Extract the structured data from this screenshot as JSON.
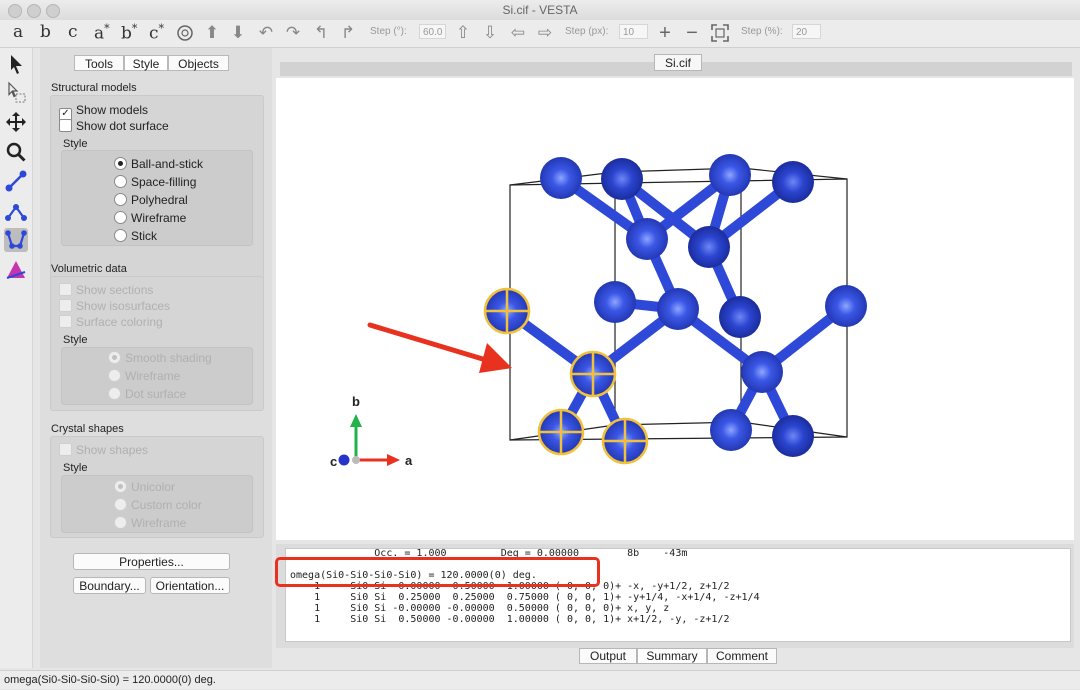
{
  "window": {
    "title": "Si.cif - VESTA"
  },
  "toolbar": {
    "letters": [
      "a",
      "b",
      "c",
      "a",
      "b",
      "c"
    ],
    "stars": [
      "",
      "",
      "",
      "*",
      "*",
      "*"
    ],
    "step_deg_label": "Step (°):",
    "step_deg_value": "60.0",
    "step_px_label": "Step (px):",
    "step_px_value": "10",
    "step_pct_label": "Step (%):",
    "step_pct_value": "20"
  },
  "panel": {
    "tabs": [
      "Tools",
      "Style",
      "Objects"
    ],
    "structural": {
      "title": "Structural models",
      "show_models": "Show models",
      "show_dot": "Show dot surface",
      "style_label": "Style",
      "styles": [
        "Ball-and-stick",
        "Space-filling",
        "Polyhedral",
        "Wireframe",
        "Stick"
      ],
      "check_mark": "✓"
    },
    "volumetric": {
      "title": "Volumetric data",
      "options": [
        "Show sections",
        "Show isosurfaces",
        "Surface coloring"
      ],
      "style_label": "Style",
      "styles": [
        "Smooth shading",
        "Wireframe",
        "Dot surface"
      ]
    },
    "crystal": {
      "title": "Crystal shapes",
      "show_shapes": "Show shapes",
      "style_label": "Style",
      "styles": [
        "Unicolor",
        "Custom color",
        "Wireframe"
      ]
    },
    "buttons": {
      "properties": "Properties...",
      "boundary": "Boundary...",
      "orientation": "Orientation..."
    }
  },
  "viewer": {
    "tab": "Si.cif",
    "axis_a": "a",
    "axis_b": "b",
    "axis_c": "c"
  },
  "output": {
    "lines": [
      "              Occ. = 1.000         Deg = 0.00000        8b    -43m",
      "",
      "omega(Si0-Si0-Si0-Si0) = 120.0000(0) deg.",
      "    1     Si0 Si  0.00000  0.50000  1.00000 ( 0, 0, 0)+ -x, -y+1/2, z+1/2",
      "    1     Si0 Si  0.25000  0.25000  0.75000 ( 0, 0, 1)+ -y+1/4, -x+1/4, -z+1/4",
      "    1     Si0 Si -0.00000 -0.00000  0.50000 ( 0, 0, 0)+ x, y, z",
      "    1     Si0 Si  0.50000 -0.00000  1.00000 ( 0, 0, 1)+ x+1/2, -y, -z+1/2"
    ],
    "tabs": [
      "Output",
      "Summary",
      "Comment"
    ]
  },
  "status": {
    "text": "omega(Si0-Si0-Si0-Si0) = 120.0000(0) deg."
  },
  "colors": {
    "atom": "#2e49d8",
    "highlight": "#e8311f",
    "ring": "#f2c13b"
  }
}
